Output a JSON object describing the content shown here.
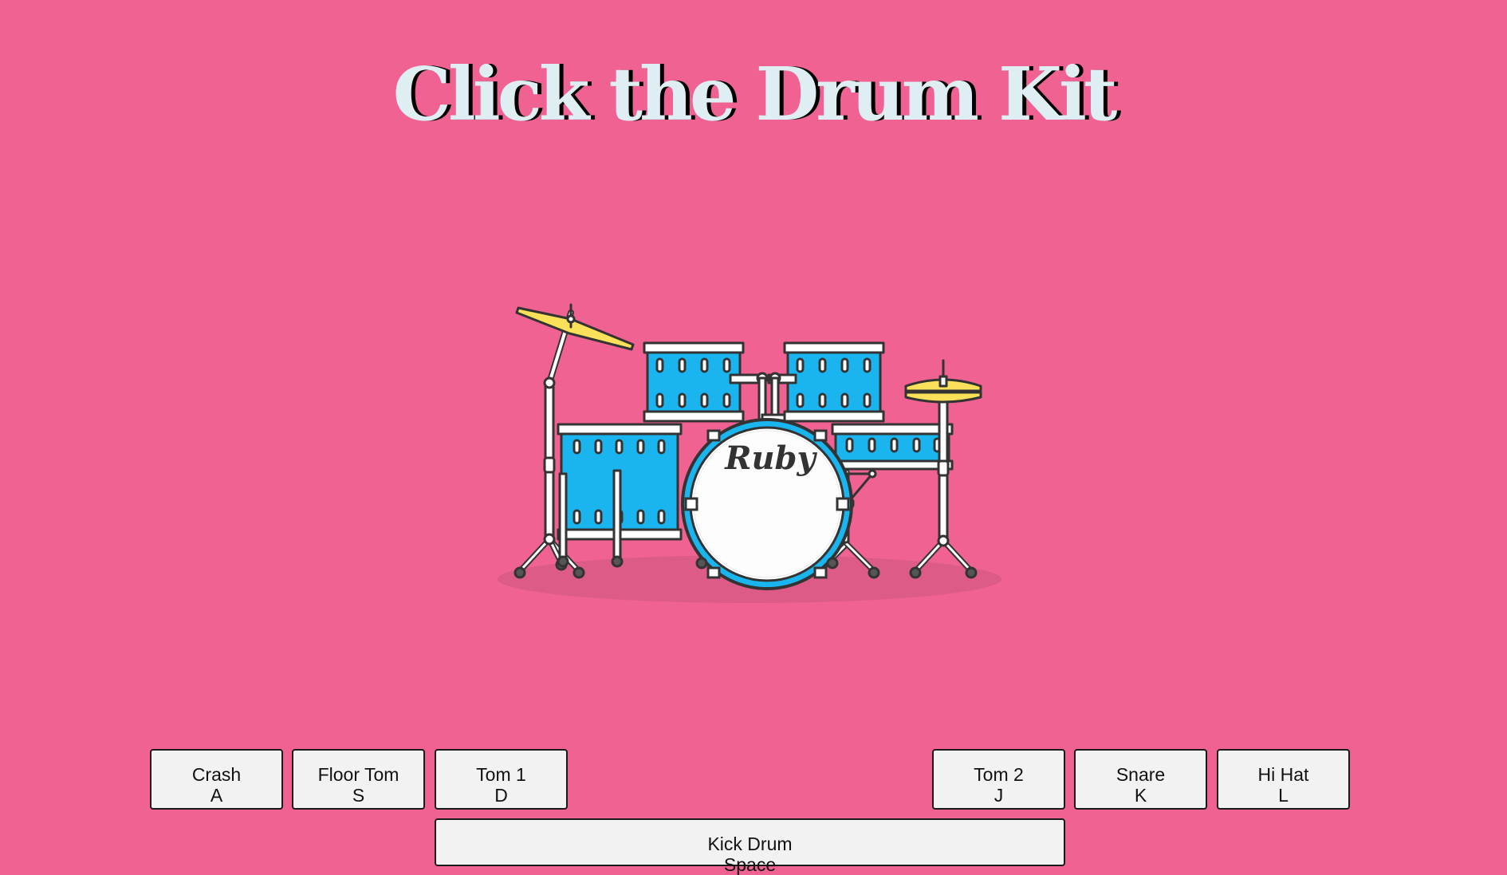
{
  "page": {
    "title": "Click the Drum Kit"
  },
  "kit": {
    "brand": "Ruby"
  },
  "pads": {
    "crash": {
      "label": "Crash",
      "key": "A"
    },
    "floor_tom": {
      "label": "Floor Tom",
      "key": "S"
    },
    "tom1": {
      "label": "Tom 1",
      "key": "D"
    },
    "tom2": {
      "label": "Tom 2",
      "key": "J"
    },
    "snare": {
      "label": "Snare",
      "key": "K"
    },
    "hihat": {
      "label": "Hi Hat",
      "key": "L"
    },
    "kick": {
      "label": "Kick Drum",
      "key": "Space"
    }
  },
  "colors": {
    "background": "#f06292",
    "drum_shell": "#1ab4ef",
    "cymbal": "#fbe05a",
    "title_text": "#dfeef3",
    "title_shadow": "#000000"
  }
}
